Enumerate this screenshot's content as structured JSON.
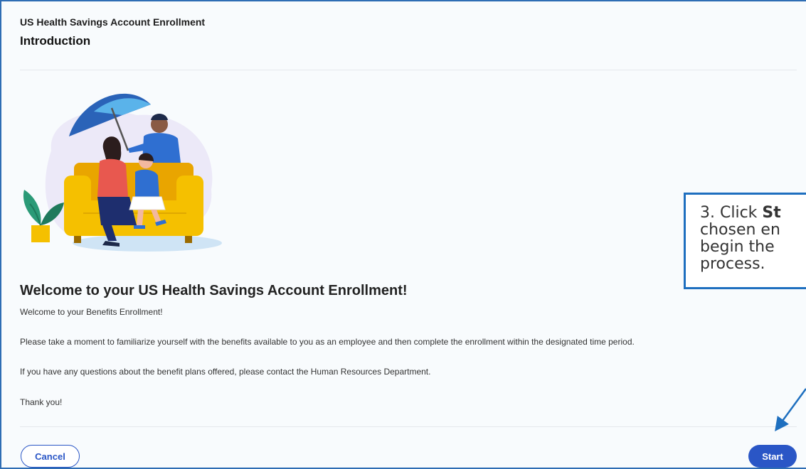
{
  "header": {
    "enrollment_title": "US Health Savings Account Enrollment",
    "page_title": "Introduction"
  },
  "content": {
    "welcome_heading": "Welcome to your US Health Savings Account Enrollment!",
    "paragraphs": [
      "Welcome to your Benefits Enrollment!",
      "Please take a moment to familiarize yourself with the benefits available to you as an employee and then complete the enrollment within the designated time period.",
      "If you have any questions about the benefit plans offered, please contact the Human Resources Department.",
      "Thank you!"
    ]
  },
  "footer": {
    "cancel_label": "Cancel",
    "start_label": "Start"
  },
  "callout": {
    "line1_prefix": "3. Click ",
    "line1_bold": "St",
    "line2": "chosen en",
    "line3": "begin the",
    "line4": "process."
  },
  "colors": {
    "frame_border": "#2e6db4",
    "primary_button": "#2a56c6",
    "callout_border": "#1e6fbf"
  }
}
